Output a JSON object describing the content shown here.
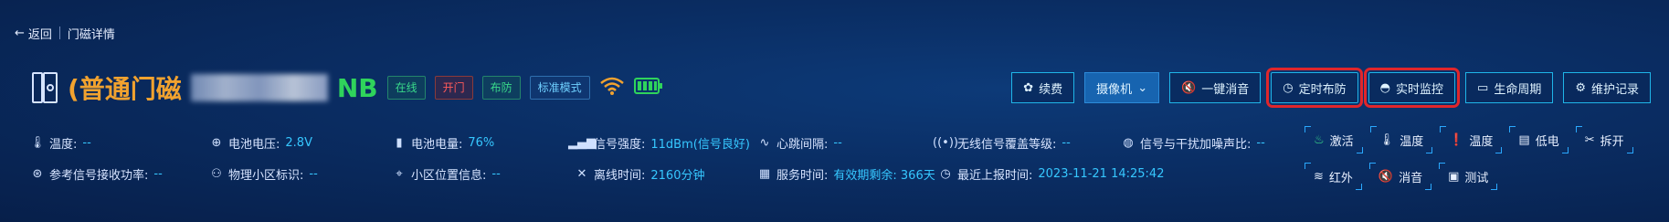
{
  "nav": {
    "back_label": "返回",
    "page_title": "门磁详情"
  },
  "device": {
    "name_prefix": "(普通门磁",
    "name_suffix": "NB",
    "tags": [
      "在线",
      "开门",
      "布防",
      "标准模式"
    ],
    "colors": {
      "name": "#f1a22f",
      "nb": "#2fd45b",
      "accent": "#36c7ff",
      "highlight": "#e0262b"
    }
  },
  "actions": [
    {
      "label": "续费",
      "icon": "gear-icon"
    },
    {
      "label": "摄像机",
      "icon": "chevron-down-icon"
    },
    {
      "label": "一键消音",
      "icon": "mute-icon"
    },
    {
      "label": "定时布防",
      "icon": "clock-icon"
    },
    {
      "label": "实时监控",
      "icon": "monitor-icon"
    },
    {
      "label": "生命周期",
      "icon": "card-icon"
    },
    {
      "label": "维护记录",
      "icon": "settings-icon"
    }
  ],
  "info_row1": [
    {
      "label": "温度:",
      "value": "--"
    },
    {
      "label": "电池电压:",
      "value": "2.8V"
    },
    {
      "label": "电池电量:",
      "value": "76%"
    },
    {
      "label": "信号强度:",
      "value": "11dBm(信号良好)"
    },
    {
      "label": "心跳间隔:",
      "value": "--"
    },
    {
      "label": "无线信号覆盖等级:",
      "value": "--"
    },
    {
      "label": "信号与干扰加噪声比:",
      "value": "--"
    }
  ],
  "info_row2": [
    {
      "label": "参考信号接收功率:",
      "value": "--"
    },
    {
      "label": "物理小区标识:",
      "value": "--"
    },
    {
      "label": "小区位置信息:",
      "value": "--"
    },
    {
      "label": "离线时间:",
      "value": "2160分钟"
    },
    {
      "label": "服务时间:",
      "value": "有效期剩余: 366天"
    },
    {
      "label": "最近上报时间:",
      "value": "2023-11-21 14:25:42"
    }
  ],
  "sensors_row1": [
    "激活",
    "温度",
    "温度",
    "低电",
    "拆开"
  ],
  "sensors_row2": [
    "红外",
    "消音",
    "测试"
  ]
}
